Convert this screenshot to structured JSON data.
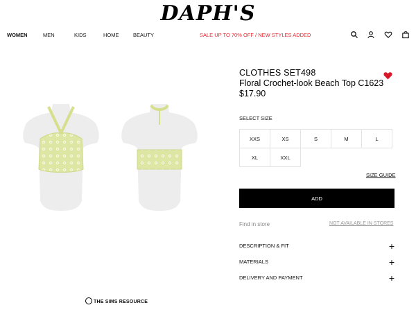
{
  "brand": {
    "logo": "DAPH'S"
  },
  "nav": {
    "items": [
      "WOMEN",
      "MEN",
      "KIDS",
      "HOME",
      "BEAUTY"
    ],
    "promo": "SALE UP TO 70% OFF / NEW STYLES ADDED",
    "icons": [
      "search-icon",
      "account-icon",
      "wishlist-icon",
      "bag-icon"
    ],
    "promo_color": "#e3262e"
  },
  "product": {
    "set_name": "CLOTHES SET498",
    "name": "Floral Crochet-look Beach Top C1623",
    "price": "$17.90",
    "favorite_color": "#d7192b"
  },
  "size_selector": {
    "label": "SELECT SIZE",
    "row1": [
      "XXS",
      "XS",
      "S",
      "M",
      "L"
    ],
    "row2": [
      "XL",
      "XXL"
    ],
    "guide": "SIZE GUIDE"
  },
  "actions": {
    "add": "ADD"
  },
  "store": {
    "find": "Find in store",
    "availability": "NOT AVAILABLE IN STORES"
  },
  "accordion": [
    "DESCRIPTION & FIT",
    "MATERIALS",
    "DELIVERY AND PAYMENT"
  ],
  "footer": {
    "watermark": "THE SIMS RESOURCE"
  }
}
